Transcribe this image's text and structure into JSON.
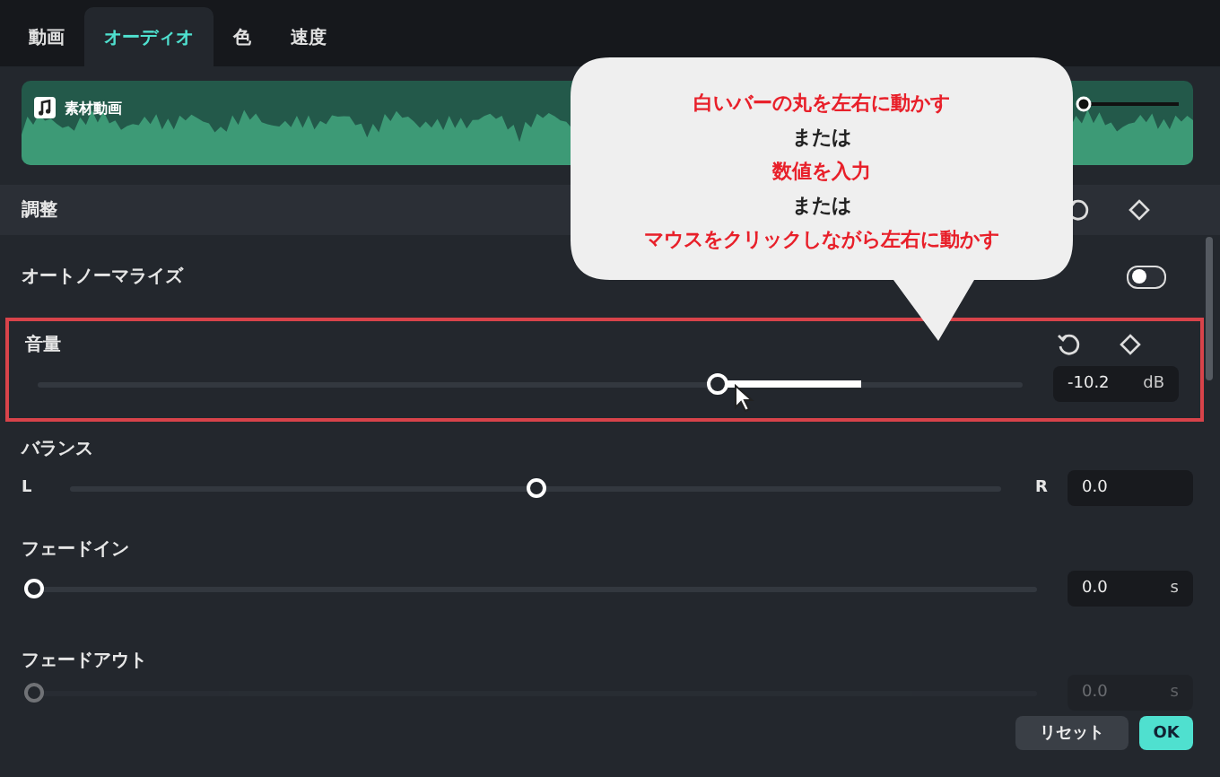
{
  "tabs": [
    {
      "label": "動画",
      "selected": false
    },
    {
      "label": "オーディオ",
      "selected": true
    },
    {
      "label": "色",
      "selected": false
    },
    {
      "label": "速度",
      "selected": false
    }
  ],
  "clip": {
    "title": "素材動画"
  },
  "section": {
    "title": "調整"
  },
  "auto_normalize": {
    "label": "オートノーマライズ",
    "on": false
  },
  "volume": {
    "label": "音量",
    "level": 0.69,
    "value": "-10.2",
    "unit": "dB",
    "highlighted": true
  },
  "balance": {
    "label": "バランス",
    "left": "L",
    "right": "R",
    "level": 0.5,
    "value": "0.0"
  },
  "fade_in": {
    "label": "フェードイン",
    "level": 0,
    "value": "0.0",
    "unit": "s"
  },
  "fade_out": {
    "label": "フェードアウト",
    "level": 0,
    "value": "0.0",
    "unit": "s"
  },
  "buttons": [
    {
      "label": "リセット",
      "kind": "secondary"
    },
    {
      "label": "OK",
      "kind": "primary"
    }
  ],
  "callout": {
    "lines": [
      {
        "text": "白いバーの丸を左右に動かす",
        "kind": "emphasis"
      },
      {
        "text": "または",
        "kind": "plain"
      },
      {
        "text": "数値を入力",
        "kind": "emphasis"
      },
      {
        "text": "または",
        "kind": "plain"
      },
      {
        "text": "マウスをクリックしながら左右に動かす",
        "kind": "emphasis"
      }
    ]
  }
}
